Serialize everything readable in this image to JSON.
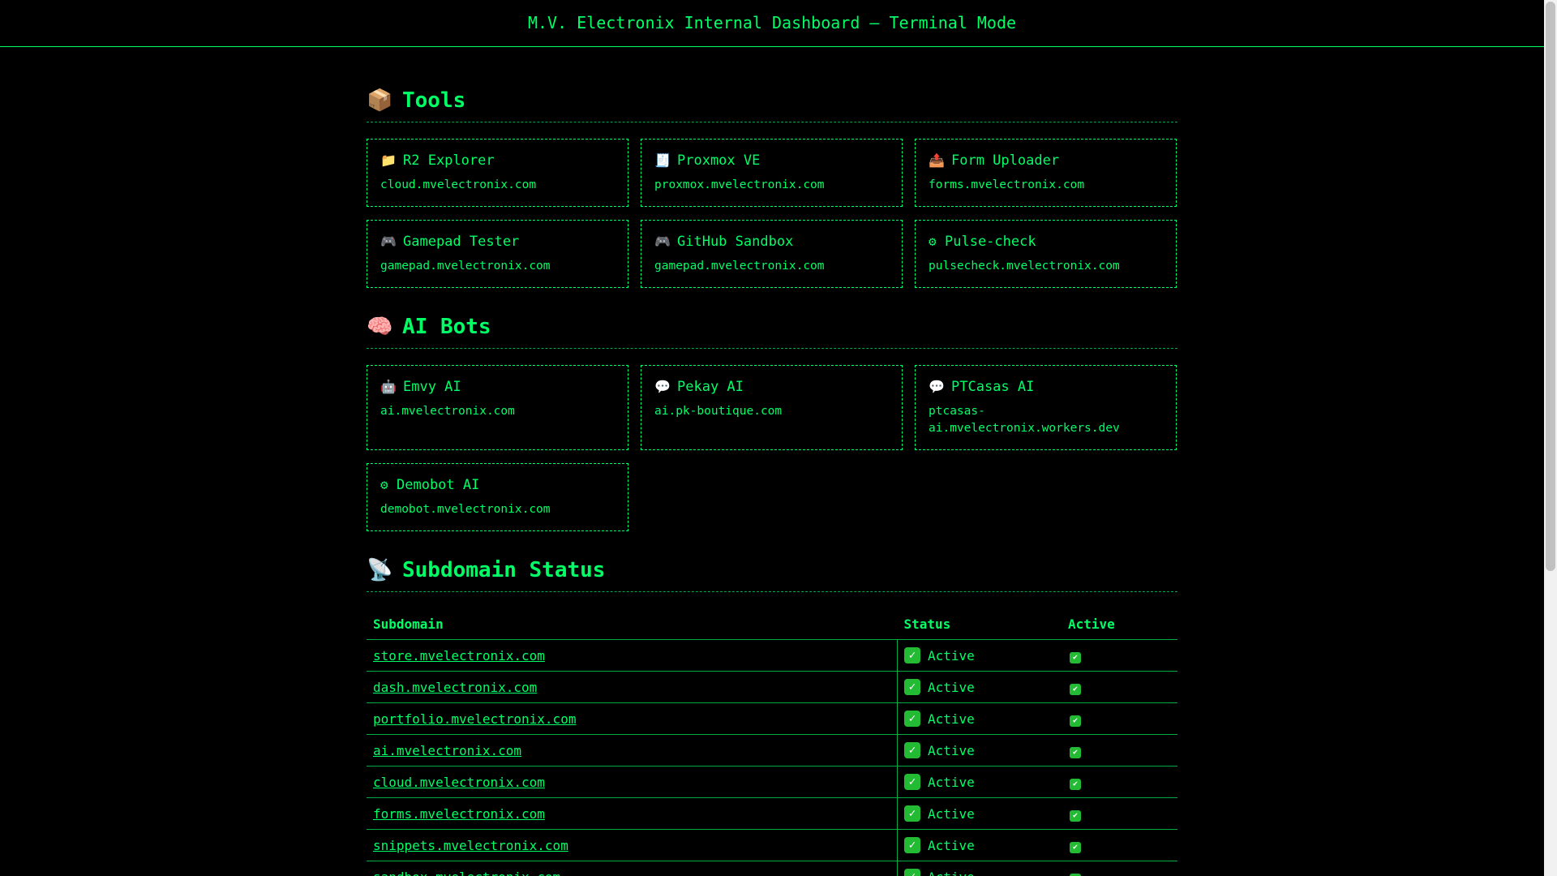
{
  "header": {
    "title": "M.V. Electronix Internal Dashboard — Terminal Mode"
  },
  "sections": {
    "tools": {
      "emoji": "📦",
      "heading": "Tools",
      "cards": [
        {
          "icon": "📁",
          "icon_name": "folder-icon",
          "title": "R2 Explorer",
          "url": "cloud.mvelectronix.com"
        },
        {
          "icon": "🧾",
          "icon_name": "receipt-icon",
          "title": "Proxmox VE",
          "url": "proxmox.mvelectronix.com"
        },
        {
          "icon": "📤",
          "icon_name": "outbox-tray-icon",
          "title": "Form Uploader",
          "url": "forms.mvelectronix.com"
        },
        {
          "icon": "🎮",
          "icon_name": "gamepad-icon",
          "title": "Gamepad Tester",
          "url": "gamepad.mvelectronix.com"
        },
        {
          "icon": "🎮",
          "icon_name": "gamepad-icon",
          "title": "GitHub Sandbox",
          "url": "gamepad.mvelectronix.com"
        },
        {
          "icon": "⚙",
          "icon_name": "gear-icon",
          "title": "Pulse-check",
          "url": "pulsecheck.mvelectronix.com"
        }
      ]
    },
    "ai_bots": {
      "emoji": "🧠",
      "heading": "AI Bots",
      "cards": [
        {
          "icon": "🤖",
          "icon_name": "robot-icon",
          "title": "Emvy AI",
          "url": "ai.mvelectronix.com"
        },
        {
          "icon": "💬",
          "icon_name": "speech-bubble-icon",
          "title": "Pekay AI",
          "url": "ai.pk-boutique.com"
        },
        {
          "icon": "💬",
          "icon_name": "speech-bubble-icon",
          "title": "PTCasas AI",
          "url": "ptcasas-ai.mvelectronix.workers.dev"
        },
        {
          "icon": "⚙",
          "icon_name": "gear-icon",
          "title": "Demobot AI",
          "url": "demobot.mvelectronix.com"
        }
      ]
    },
    "status": {
      "emoji": "📡",
      "heading": "Subdomain Status",
      "columns": [
        "Subdomain",
        "Status",
        "Active"
      ],
      "rows": [
        {
          "subdomain": "store.mvelectronix.com",
          "status": "Active",
          "active": "✔"
        },
        {
          "subdomain": "dash.mvelectronix.com",
          "status": "Active",
          "active": "✔"
        },
        {
          "subdomain": "portfolio.mvelectronix.com",
          "status": "Active",
          "active": "✔"
        },
        {
          "subdomain": "ai.mvelectronix.com",
          "status": "Active",
          "active": "✔"
        },
        {
          "subdomain": "cloud.mvelectronix.com",
          "status": "Active",
          "active": "✔"
        },
        {
          "subdomain": "forms.mvelectronix.com",
          "status": "Active",
          "active": "✔"
        },
        {
          "subdomain": "snippets.mvelectronix.com",
          "status": "Active",
          "active": "✔"
        },
        {
          "subdomain": "sandbox.mvelectronix.com",
          "status": "Active",
          "active": "✔"
        }
      ]
    }
  },
  "colors": {
    "background": "#000000",
    "accent": "#00ff66",
    "check_green": "#22bb33"
  }
}
